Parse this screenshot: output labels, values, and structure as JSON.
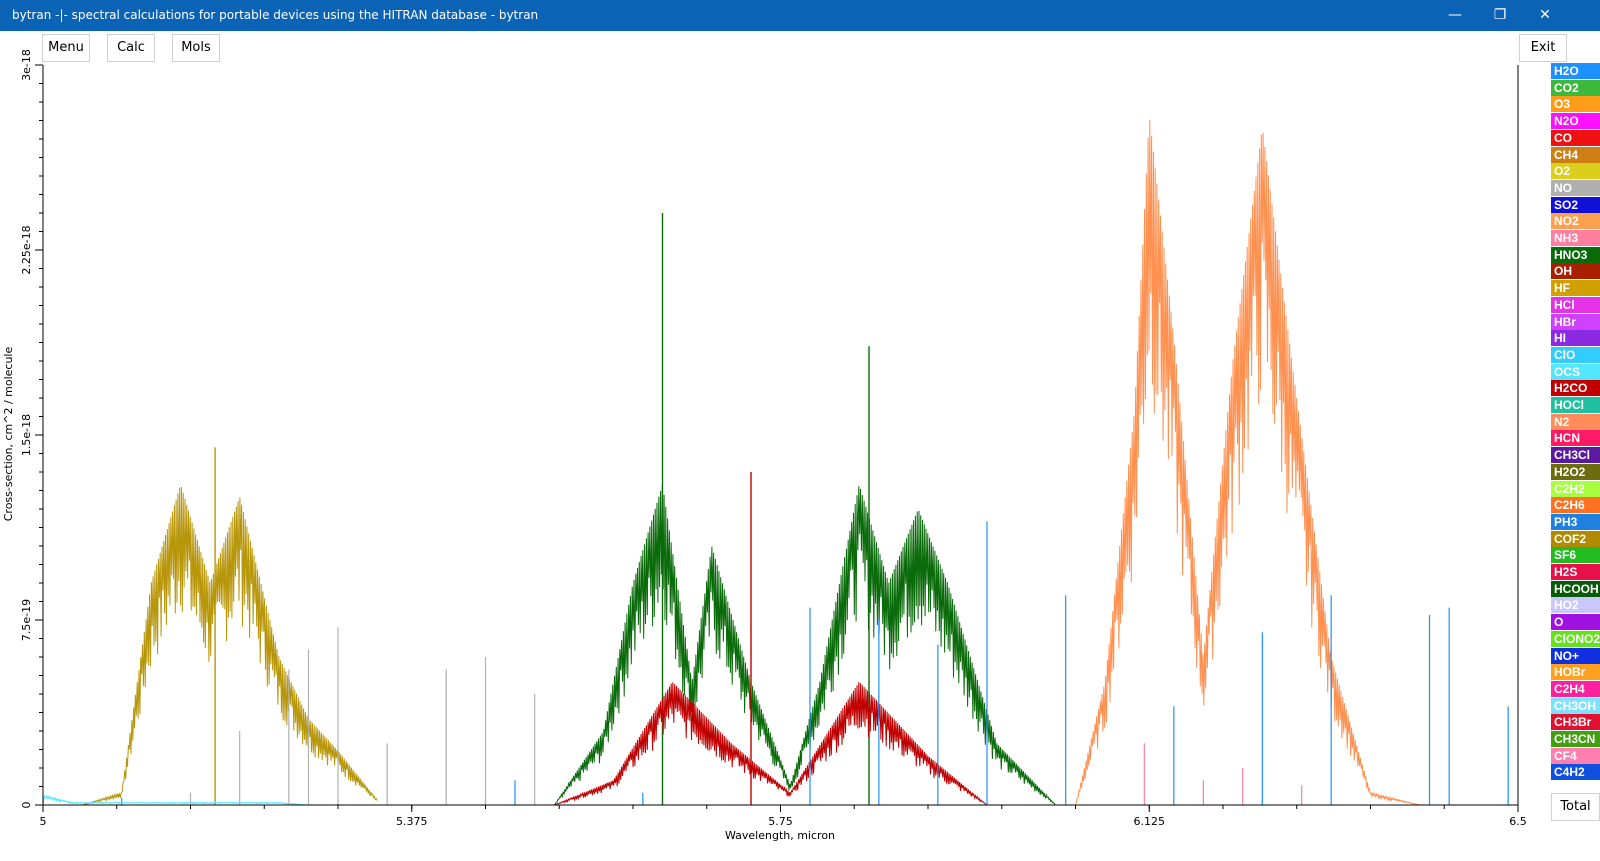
{
  "window": {
    "title": "bytran -|- spectral calculations for portable devices using the HITRAN database - bytran",
    "minimize_glyph": "—",
    "maximize_glyph": "❐",
    "close_glyph": "✕"
  },
  "toolbar": {
    "menu": "Menu",
    "calc": "Calc",
    "mols": "Mols",
    "exit": "Exit"
  },
  "molecules": [
    {
      "name": "H2O",
      "color": "#1e90ff"
    },
    {
      "name": "CO2",
      "color": "#3cb83c"
    },
    {
      "name": "O3",
      "color": "#ff9d1a"
    },
    {
      "name": "N2O",
      "color": "#ff10ff"
    },
    {
      "name": "CO",
      "color": "#ee1111"
    },
    {
      "name": "CH4",
      "color": "#cd7f14"
    },
    {
      "name": "O2",
      "color": "#dbcf1c"
    },
    {
      "name": "NO",
      "color": "#b0b0b0"
    },
    {
      "name": "SO2",
      "color": "#1010d8"
    },
    {
      "name": "NO2",
      "color": "#ffa050"
    },
    {
      "name": "NH3",
      "color": "#ff7fa0"
    },
    {
      "name": "HNO3",
      "color": "#0a6b0a"
    },
    {
      "name": "OH",
      "color": "#a82000"
    },
    {
      "name": "HF",
      "color": "#d0a000"
    },
    {
      "name": "HCl",
      "color": "#e632e6"
    },
    {
      "name": "HBr",
      "color": "#d040ff"
    },
    {
      "name": "HI",
      "color": "#8a2be2"
    },
    {
      "name": "ClO",
      "color": "#33ccff"
    },
    {
      "name": "OCS",
      "color": "#55e6ff"
    },
    {
      "name": "H2CO",
      "color": "#c00000"
    },
    {
      "name": "HOCl",
      "color": "#20c0a0"
    },
    {
      "name": "N2",
      "color": "#ff8c5a"
    },
    {
      "name": "HCN",
      "color": "#ff1a66"
    },
    {
      "name": "CH3Cl",
      "color": "#5b1aa0"
    },
    {
      "name": "H2O2",
      "color": "#6b6b10"
    },
    {
      "name": "C2H2",
      "color": "#a8ff40"
    },
    {
      "name": "C2H6",
      "color": "#ff7020"
    },
    {
      "name": "PH3",
      "color": "#2080e0"
    },
    {
      "name": "COF2",
      "color": "#b08a00"
    },
    {
      "name": "SF6",
      "color": "#22bb22"
    },
    {
      "name": "H2S",
      "color": "#e8104a"
    },
    {
      "name": "HCOOH",
      "color": "#0a5a0a"
    },
    {
      "name": "HO2",
      "color": "#c8c8ff"
    },
    {
      "name": "O",
      "color": "#a010e0"
    },
    {
      "name": "ClONO2",
      "color": "#66e020"
    },
    {
      "name": "NO+",
      "color": "#1030e0"
    },
    {
      "name": "HOBr",
      "color": "#ffa020"
    },
    {
      "name": "C2H4",
      "color": "#ff20a0"
    },
    {
      "name": "CH3OH",
      "color": "#80e0ff"
    },
    {
      "name": "CH3Br",
      "color": "#e01030"
    },
    {
      "name": "CH3CN",
      "color": "#40a010"
    },
    {
      "name": "CF4",
      "color": "#ff80b0"
    },
    {
      "name": "C4H2",
      "color": "#1050e0"
    }
  ],
  "total_button": "Total",
  "chart_data": {
    "type": "line",
    "xlabel": "Wavelength, micron",
    "ylabel": "Cross-section,  cm^2 / molecule",
    "xlim": [
      5.0,
      6.5
    ],
    "ylim": [
      0,
      3e-18
    ],
    "x_ticks": [
      "5",
      "5.375",
      "5.75",
      "6.125",
      "6.5"
    ],
    "y_ticks": [
      "0",
      "7.5e-19",
      "1.5e-18",
      "2.25e-18",
      "3e-18"
    ],
    "series": [
      {
        "name": "HF",
        "color": "#b8960a",
        "envelope": [
          [
            5.04,
            0
          ],
          [
            5.08,
            5e-20
          ],
          [
            5.11,
            9e-19
          ],
          [
            5.14,
            1.3e-18
          ],
          [
            5.17,
            9e-19
          ],
          [
            5.2,
            1.25e-18
          ],
          [
            5.24,
            6e-19
          ],
          [
            5.27,
            3.5e-19
          ],
          [
            5.3,
            2.2e-19
          ],
          [
            5.34,
            2e-20
          ]
        ],
        "peaks": [
          [
            5.175,
            1.45e-18
          ]
        ]
      },
      {
        "name": "NO",
        "color": "#b0b0b0",
        "lines": [
          [
            5.15,
            5e-20
          ],
          [
            5.2,
            3e-19
          ],
          [
            5.25,
            5.5e-19
          ],
          [
            5.27,
            6.3e-19
          ],
          [
            5.3,
            7.2e-19
          ],
          [
            5.35,
            2.5e-19
          ],
          [
            5.41,
            5.5e-19
          ],
          [
            5.45,
            6e-19
          ],
          [
            5.5,
            4.5e-19
          ]
        ]
      },
      {
        "name": "HNO3",
        "color": "#0a6b0a",
        "envelope": [
          [
            5.52,
            0
          ],
          [
            5.57,
            3e-19
          ],
          [
            5.6,
            9e-19
          ],
          [
            5.63,
            1.3e-18
          ],
          [
            5.66,
            5e-19
          ],
          [
            5.68,
            1.05e-18
          ],
          [
            5.72,
            5e-19
          ],
          [
            5.76,
            8e-20
          ],
          [
            5.79,
            5e-19
          ],
          [
            5.83,
            1.3e-18
          ],
          [
            5.86,
            9e-19
          ],
          [
            5.89,
            1.2e-18
          ],
          [
            5.92,
            9e-19
          ],
          [
            5.97,
            2.5e-19
          ],
          [
            6.03,
            0
          ]
        ],
        "peaks": [
          [
            5.63,
            2.4e-18
          ],
          [
            5.84,
            1.86e-18
          ]
        ]
      },
      {
        "name": "H2CO",
        "color": "#c00000",
        "envelope": [
          [
            5.52,
            0
          ],
          [
            5.58,
            1e-19
          ],
          [
            5.64,
            5e-19
          ],
          [
            5.7,
            2.5e-19
          ],
          [
            5.76,
            5e-20
          ],
          [
            5.83,
            5e-19
          ],
          [
            5.9,
            2e-19
          ],
          [
            5.96,
            0
          ]
        ],
        "peaks": [
          [
            5.72,
            1.35e-18
          ]
        ]
      },
      {
        "name": "N2",
        "color": "#ff9050",
        "envelope": [
          [
            6.05,
            0
          ],
          [
            6.08,
            5e-19
          ],
          [
            6.11,
            1.6e-18
          ],
          [
            6.125,
            2.8e-18
          ],
          [
            6.15,
            1.9e-18
          ],
          [
            6.18,
            6e-19
          ],
          [
            6.21,
            1.8e-18
          ],
          [
            6.24,
            2.75e-18
          ],
          [
            6.27,
            1.8e-18
          ],
          [
            6.31,
            6e-19
          ],
          [
            6.35,
            5e-20
          ],
          [
            6.4,
            0
          ]
        ]
      },
      {
        "name": "H2O",
        "color": "#1e90ff",
        "lines": [
          [
            5.08,
            3e-20
          ],
          [
            5.48,
            1e-19
          ],
          [
            5.61,
            5e-20
          ],
          [
            5.78,
            8e-19
          ],
          [
            5.85,
            7.5e-19
          ],
          [
            5.91,
            6.5e-19
          ],
          [
            5.96,
            1.15e-18
          ],
          [
            6.04,
            8.5e-19
          ],
          [
            6.15,
            4e-19
          ],
          [
            6.24,
            7e-19
          ],
          [
            6.31,
            8.5e-19
          ],
          [
            6.41,
            7.7e-19
          ],
          [
            6.43,
            8e-19
          ],
          [
            6.49,
            4e-19
          ]
        ]
      },
      {
        "name": "OCS",
        "color": "#55e6ff",
        "envelope": [
          [
            5.0,
            4e-20
          ],
          [
            5.03,
            1e-20
          ],
          [
            5.24,
            1e-20
          ],
          [
            5.27,
            0
          ]
        ]
      },
      {
        "name": "NH3",
        "color": "#ff7fa0",
        "lines": [
          [
            6.12,
            2.5e-19
          ],
          [
            6.18,
            1e-19
          ],
          [
            6.22,
            1.5e-19
          ],
          [
            6.28,
            8e-20
          ]
        ]
      }
    ]
  }
}
